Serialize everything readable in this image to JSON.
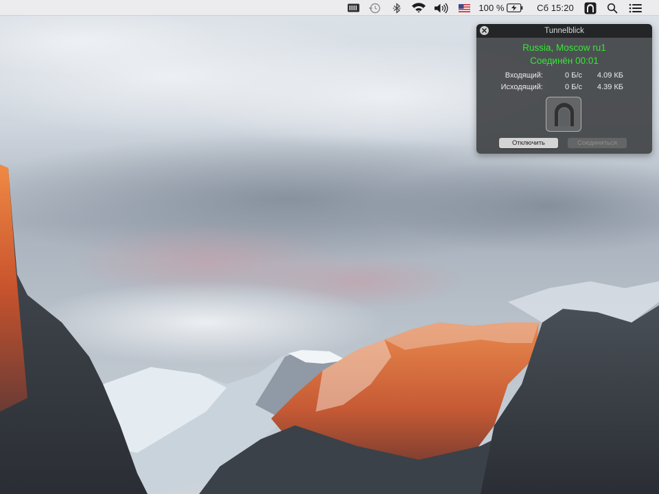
{
  "menubar": {
    "battery_percent": "100 %",
    "clock": "Сб 15:20",
    "icons": [
      "battery-status-icon",
      "time-machine-icon",
      "bluetooth-icon",
      "wifi-icon",
      "volume-icon",
      "us-flag-icon",
      "battery-charging-icon",
      "tunnelblick-icon",
      "spotlight-search-icon",
      "notification-center-icon"
    ]
  },
  "hud": {
    "title": "Tunnelblick",
    "connection_name": "Russia, Moscow ru1",
    "status": "Соединён 00:01",
    "status_color": "#37e637",
    "incoming": {
      "label": "Входящий:",
      "rate": "0 Б/с",
      "total": "4.09 КБ"
    },
    "outgoing": {
      "label": "Исходящий:",
      "rate": "0 Б/с",
      "total": "4.39 КБ"
    },
    "disconnect_label": "Отключить",
    "connect_label": "Соединиться"
  },
  "colors": {
    "menubar_bg": "#ececee",
    "hud_bg": "#3e4042",
    "status_green": "#37e637",
    "sky": "#c9d0d7",
    "rock_lit": "#d2683a"
  }
}
